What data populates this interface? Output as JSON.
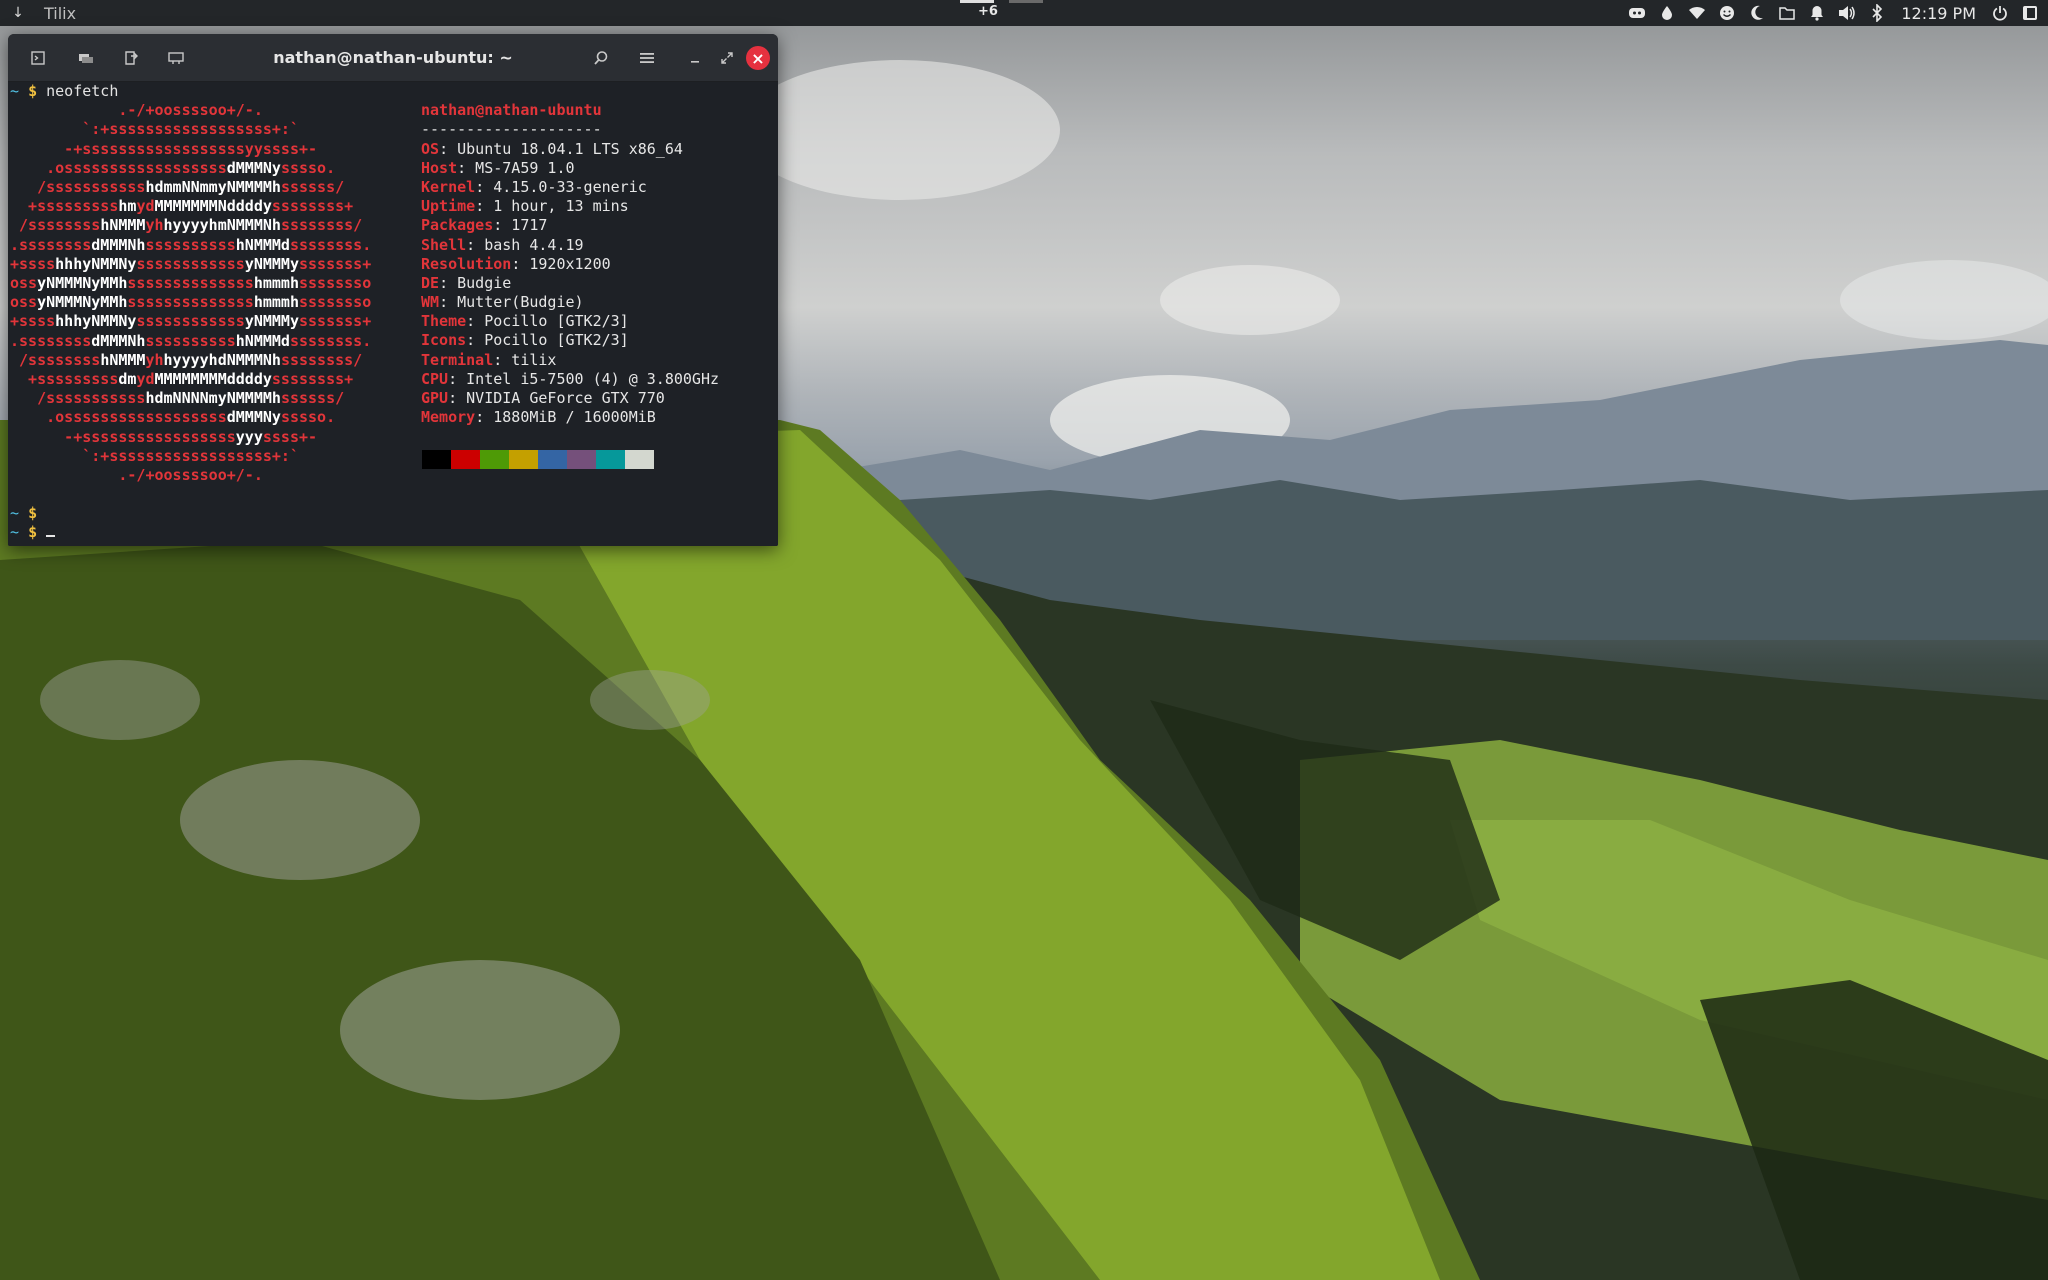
{
  "panel": {
    "app_name": "Tilix",
    "workspace_count": "+6",
    "clock": "12:19 PM",
    "tray_icons": [
      "discord-icon",
      "drop-icon",
      "wifi-icon",
      "emoji-icon",
      "night-mode-icon",
      "folder-icon",
      "notification-bell-icon",
      "volume-icon",
      "bluetooth-icon",
      "power-icon",
      "raven-panel-icon"
    ]
  },
  "terminal": {
    "title": "nathan@nathan-ubuntu: ~",
    "prompt_tilde": "~",
    "prompt_dollar": "$",
    "command": "neofetch",
    "logo_lines": [
      "            .-/+oossssoo+/-.",
      "        `:+ssssssssssssssssss+:`",
      "      -+ssssssssssssssssssyyssss+-",
      "    .ossssssssssssssssss|dMMMNy|sssso.",
      "   /sssssssssss|hdmmNNmmyNMMMMh|ssssss/",
      "  +sssssssss|hm|yd|MMMMMMMNddddy|ssssssss+",
      " /ssssssss|hNMMM|yh|hyyyyhmNMMMNh|ssssssss/",
      ".ssssssss|dMMMNh|ssssssssss|hNMMMd|ssssssss.",
      "+ssss|hhhyNMMNy|ssssssssssss|yNMMMy|sssssss+",
      "oss|yNMMMNyMMh|ssssssssssssss|hmmmh|ssssssso",
      "oss|yNMMMNyMMh|ssssssssssssss|hmmmh|ssssssso",
      "+ssss|hhhyNMMNy|ssssssssssss|yNMMMy|sssssss+",
      ".ssssssss|dMMMNh|ssssssssss|hNMMMd|ssssssss.",
      " /ssssssss|hNMMM|yh|hyyyyhdNMMMNh|ssssssss/",
      "  +sssssssss|dm|yd|MMMMMMMMddddy|ssssssss+",
      "   /sssssssssss|hdmNNNNmyNMMMMh|ssssss/",
      "    .ossssssssssssssssss|dMMMNy|sssso.",
      "      -+sssssssssssssssss|yyy|ssss+-",
      "        `:+ssssssssssssssssss+:`",
      "            .-/+oossssoo+/-."
    ],
    "info_user": "nathan@nathan-ubuntu",
    "info_separator": "--------------------",
    "info": [
      {
        "key": "OS",
        "value": "Ubuntu 18.04.1 LTS x86_64"
      },
      {
        "key": "Host",
        "value": "MS-7A59 1.0"
      },
      {
        "key": "Kernel",
        "value": "4.15.0-33-generic"
      },
      {
        "key": "Uptime",
        "value": "1 hour, 13 mins"
      },
      {
        "key": "Packages",
        "value": "1717"
      },
      {
        "key": "Shell",
        "value": "bash 4.4.19"
      },
      {
        "key": "Resolution",
        "value": "1920x1200"
      },
      {
        "key": "DE",
        "value": "Budgie"
      },
      {
        "key": "WM",
        "value": "Mutter(Budgie)"
      },
      {
        "key": "Theme",
        "value": "Pocillo [GTK2/3]"
      },
      {
        "key": "Icons",
        "value": "Pocillo [GTK2/3]"
      },
      {
        "key": "Terminal",
        "value": "tilix"
      },
      {
        "key": "CPU",
        "value": "Intel i5-7500 (4) @ 3.800GHz"
      },
      {
        "key": "GPU",
        "value": "NVIDIA GeForce GTX 770"
      },
      {
        "key": "Memory",
        "value": "1880MiB / 16000MiB"
      }
    ],
    "color_swatches": [
      "#000000",
      "#cc0000",
      "#4e9a06",
      "#c4a000",
      "#3465a4",
      "#75507b",
      "#06989a",
      "#d3d7cf"
    ]
  }
}
